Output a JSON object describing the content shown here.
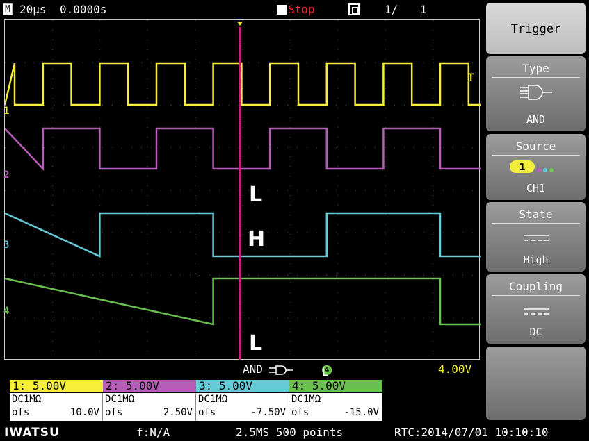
{
  "topbar": {
    "mode_icon": "M",
    "timebase": "20µs",
    "position": "0.0000s",
    "run_state": "Stop",
    "memory_icon": "memory-icon",
    "page": "1/",
    "count": "1"
  },
  "channel_markers": [
    "1",
    "2",
    "3",
    "4"
  ],
  "trigger_level_marker": "T",
  "state_labels": {
    "ch2": "L",
    "ch3": "H",
    "ch4": "L"
  },
  "trigger_info": {
    "mode": "AND",
    "gate_icon": "and-gate-icon",
    "conditions": [
      {
        "ch": "1",
        "state": "H",
        "color": "#f2ee3a"
      },
      {
        "ch": "2",
        "state": "L",
        "color": "#c05cc0"
      },
      {
        "ch": "3",
        "state": "H",
        "color": "#5ed0e0"
      },
      {
        "ch": "4",
        "state": "L",
        "color": "#6bc84c"
      }
    ],
    "level": "4.00V"
  },
  "channels": [
    {
      "label": "1: 5.00V",
      "coupling": "DC1MΩ",
      "ofs_label": "ofs",
      "ofs": "10.0V",
      "color": "#f5ef3c"
    },
    {
      "label": "2: 5.00V",
      "coupling": "DC1MΩ",
      "ofs_label": "ofs",
      "ofs": "2.50V",
      "color": "#b65db8"
    },
    {
      "label": "3: 5.00V",
      "coupling": "DC1MΩ",
      "ofs_label": "ofs",
      "ofs": "-7.50V",
      "color": "#63cad6"
    },
    {
      "label": "4: 5.00V",
      "coupling": "DC1MΩ",
      "ofs_label": "ofs",
      "ofs": "-15.0V",
      "color": "#69bf4f"
    }
  ],
  "status": {
    "brand": "IWATSU",
    "freq": "f:N/A",
    "sampling": "2.5MS 500 points",
    "rtc": "RTC:2014/07/01 10:10:10"
  },
  "menu": {
    "title": "Trigger",
    "items": [
      {
        "title": "Type",
        "value": "AND",
        "icon": "and-gate-icon"
      },
      {
        "title": "Source",
        "value": "CH1",
        "icon": "source-ch1-icon"
      },
      {
        "title": "State",
        "value": "High",
        "icon": "level-dash-icon"
      },
      {
        "title": "Coupling",
        "value": "DC",
        "icon": "level-dash-icon"
      }
    ]
  },
  "colors": {
    "ch1": "#f5ef3c",
    "ch2": "#b65db8",
    "ch3": "#63cad6",
    "ch4": "#69bf4f",
    "cursor": "#e0157e",
    "stop": "#ff2a2a"
  },
  "waveforms": {
    "ch1": {
      "type": "square",
      "high": 1,
      "low": 0,
      "period_us": 20
    },
    "ch2": {
      "type": "square",
      "high": 1,
      "low": 0,
      "period_us": 40
    },
    "ch3": {
      "type": "square",
      "high": 1,
      "low": 0,
      "period_us": 80
    },
    "ch4": {
      "type": "square",
      "high": 1,
      "low": 0,
      "period_us": 160
    }
  }
}
